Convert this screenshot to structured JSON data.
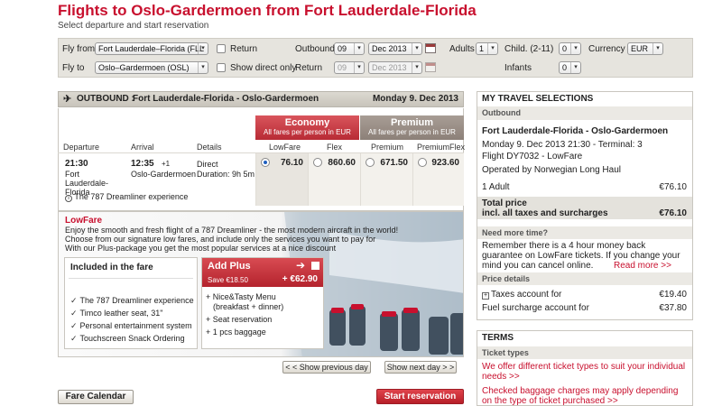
{
  "header": {
    "title": "Flights to Oslo-Gardermoen from Fort Lauderdale-Florida",
    "subtitle": "Select departure and start reservation"
  },
  "search": {
    "fly_from_label": "Fly from",
    "fly_from_value": "Fort Lauderdale–Florida (FLL",
    "fly_to_label": "Fly to",
    "fly_to_value": "Oslo–Gardermoen (OSL)",
    "return_label": "Return",
    "direct_label": "Show direct only",
    "outbound_label": "Outbound",
    "outbound_day": "09",
    "outbound_month": "Dec 2013",
    "return_date_label": "Return",
    "return_day": "09",
    "return_month": "Dec 2013",
    "adults_label": "Adults",
    "adults_value": "1",
    "child_label": "Child. (2-11)",
    "child_value": "0",
    "infants_label": "Infants",
    "infants_value": "0",
    "currency_label": "Currency",
    "currency_value": "EUR"
  },
  "outbound": {
    "heading": "OUTBOUND :",
    "route": "Fort Lauderdale-Florida - Oslo-Gardermoen",
    "date": "Monday 9. Dec 2013",
    "economy_title": "Economy",
    "economy_sub": "All fares per person in EUR",
    "premium_title": "Premium",
    "premium_sub": "All fares per person in EUR",
    "col_departure": "Departure",
    "col_arrival": "Arrival",
    "col_details": "Details",
    "fare_cols": [
      "LowFare",
      "Flex",
      "Premium",
      "PremiumFlex"
    ],
    "flight": {
      "dep_time": "21:30",
      "dep_city": "Fort Lauderdale-Florida",
      "arr_time": "12:35",
      "arr_plus": "+1",
      "arr_city": "Oslo-Gardermoen",
      "type": "Direct",
      "duration": "Duration: 9h 5m"
    },
    "prices": [
      "76.10",
      "860.60",
      "671.50",
      "923.60"
    ],
    "selected_index": 0,
    "dreamliner": "The 787 Dreamliner experience"
  },
  "promo": {
    "title": "LowFare",
    "text1": "Enjoy the smooth and fresh flight of a 787 Dreamliner - the most modern aircraft in the world!",
    "text2": "Choose from our signature low fares, and include only the services you want to pay for",
    "text3": "With our Plus-package you get the most popular services at a nice discount",
    "included_title": "Included in the fare",
    "included": [
      "The 787 Dreamliner experience",
      "Timco leather seat, 31\"",
      "Personal entertainment system",
      "Touchscreen Snack Ordering"
    ],
    "addplus_title": "Add Plus",
    "addplus_save": "Save €18.50",
    "addplus_price": "+ €62.90",
    "addplus_items": [
      "Nice&Tasty Menu",
      "(breakfast + dinner)",
      "Seat reservation",
      "1 pcs baggage"
    ]
  },
  "nav": {
    "prev": "< < Show previous day",
    "next": "Show next day > >",
    "fare_calendar": "Fare Calendar",
    "start": "Start reservation"
  },
  "sidebar": {
    "title": "MY TRAVEL SELECTIONS",
    "outbound_label": "Outbound",
    "route": "Fort Lauderdale-Florida - Oslo-Gardermoen",
    "line1": "Monday 9. Dec 2013 21:30 - Terminal: 3",
    "line2": "Flight DY7032 - LowFare",
    "line3": "Operated by Norwegian Long Haul",
    "adult_label": "1 Adult",
    "adult_price": "€76.10",
    "total_label1": "Total price",
    "total_label2": "incl. all taxes and surcharges",
    "total_price": "€76.10",
    "needtime_title": "Need more time?",
    "needtime_1": "Remember there is a 4 hour money back",
    "needtime_2": "guarantee on LowFare tickets. If you change your",
    "needtime_3": "mind you can cancel online.",
    "read_more": "Read more >>",
    "price_details": "Price details",
    "taxes_label": "Taxes account for",
    "taxes_value": "€19.40",
    "fuel_label": "Fuel surcharge account for",
    "fuel_value": "€37.80",
    "terms_title": "TERMS",
    "ticket_types": "Ticket types",
    "ticket_1": "We offer different ticket types to suit your individual",
    "ticket_2": "needs >>",
    "bag_1": "Checked baggage charges may apply depending",
    "bag_2": "on the type of ticket purchased >>"
  }
}
